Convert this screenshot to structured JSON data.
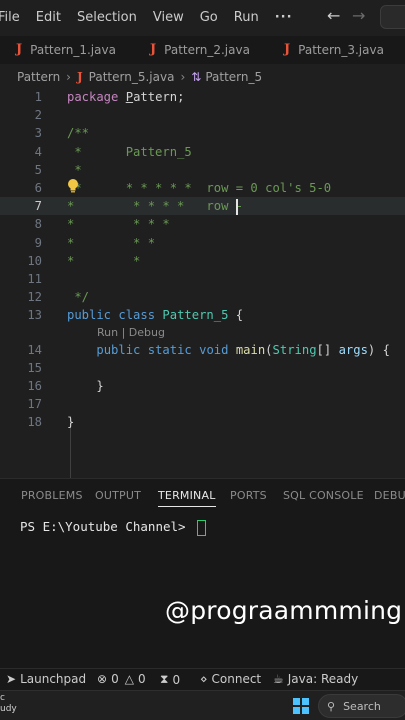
{
  "menu": {
    "items": [
      "File",
      "Edit",
      "Selection",
      "View",
      "Go",
      "Run"
    ],
    "more": "···"
  },
  "tabs": [
    {
      "icon": "J",
      "label": "Pattern_1.java"
    },
    {
      "icon": "J",
      "label": "Pattern_2.java"
    },
    {
      "icon": "J",
      "label": "Pattern_3.java"
    }
  ],
  "breadcrumb": {
    "folder": "Pattern",
    "file_icon": "J",
    "file": "Pattern_5.java",
    "symbol": "Pattern_5"
  },
  "editor": {
    "lines": [
      {
        "n": "1",
        "html": "<span class=\"kw2\">package</span> <span class=\"txt\"><span class=\"pat-underline\">P</span>attern;</span>"
      },
      {
        "n": "2",
        "html": ""
      },
      {
        "n": "3",
        "html": "<span class=\"cmt\">/**</span>"
      },
      {
        "n": "4",
        "html": "<span class=\"cmt\"> *      Pattern_5</span>"
      },
      {
        "n": "5",
        "html": "<span class=\"cmt\"> *</span>"
      },
      {
        "n": "6",
        "html": "<span class=\"cmt\"> *      * * * * *  row = 0 col's 5-0</span>"
      },
      {
        "n": "7",
        "html": "<span class=\"cmt\">*        * * * *   row -</span>"
      },
      {
        "n": "8",
        "html": "<span class=\"cmt\">*        * * *</span>"
      },
      {
        "n": "9",
        "html": "<span class=\"cmt\">*        * *</span>"
      },
      {
        "n": "10",
        "html": "<span class=\"cmt\">*        *</span>"
      },
      {
        "n": "11",
        "html": ""
      },
      {
        "n": "12",
        "html": "<span class=\"cmt\"> */</span>"
      },
      {
        "n": "13",
        "html": "<span class=\"kw\">public</span> <span class=\"kw\">class</span> <span class=\"type\">Pattern_5</span> <span class=\"txt\">{</span>"
      },
      {
        "n": "14",
        "html": "    <span class=\"kw\">public</span> <span class=\"kw\">static</span> <span class=\"kw\">void</span> <span class=\"fn\">main</span><span class=\"txt\">(</span><span class=\"type\">String</span><span class=\"txt\">[] </span><span class=\"var\">args</span><span class=\"txt\">) {</span>"
      },
      {
        "n": "15",
        "html": ""
      },
      {
        "n": "16",
        "html": "    <span class=\"txt\">}</span>"
      },
      {
        "n": "17",
        "html": ""
      },
      {
        "n": "18",
        "html": "<span class=\"txt\">}</span>"
      }
    ],
    "current_line": "7",
    "codelens": "Run | Debug"
  },
  "panel": {
    "tabs": [
      "PROBLEMS",
      "OUTPUT",
      "TERMINAL",
      "PORTS",
      "SQL CONSOLE",
      "DEBUG"
    ],
    "active_tab": "TERMINAL",
    "prompt": "PS E:\\Youtube Channel> "
  },
  "watermark": "@prograammming",
  "status": {
    "launchpad": "Launchpad",
    "errors": "0",
    "warnings": "0",
    "ports": "0",
    "connect": "Connect",
    "java": "Java: Ready"
  },
  "taskbar": {
    "weather_line1": "c",
    "weather_line2": "udy",
    "search": "Search"
  },
  "colors": {
    "java_icon": "#e8543a",
    "comment": "#6a9955",
    "keyword": "#569cd6",
    "type": "#4ec9b0",
    "terminal_cursor": "#2ecc71",
    "windows_logo": "#4cc2ff"
  }
}
